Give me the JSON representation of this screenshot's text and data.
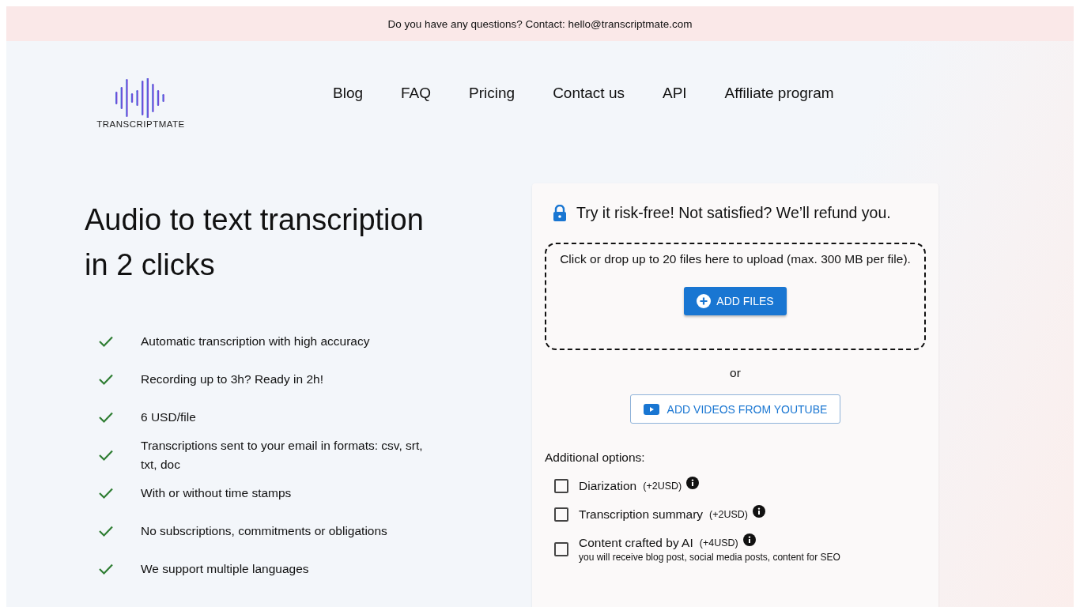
{
  "top_bar": {
    "text": "Do you have any questions? Contact: hello@transcriptmate.com"
  },
  "logo": {
    "text": "TRANSCRIPTMATE"
  },
  "nav": [
    {
      "label": "Blog"
    },
    {
      "label": "FAQ"
    },
    {
      "label": "Pricing"
    },
    {
      "label": "Contact us"
    },
    {
      "label": "API"
    },
    {
      "label": "Affiliate program"
    }
  ],
  "hero": {
    "title_lines": [
      "Audio to text transcription",
      "in 2 clicks"
    ],
    "features": [
      "Automatic transcription with high accuracy",
      "Recording up to 3h? Ready in 2h!",
      "6 USD/file",
      "Transcriptions sent to your email in formats: csv, srt, txt, doc",
      "With or without time stamps",
      "No subscriptions, commitments or obligations",
      "We support multiple languages"
    ]
  },
  "card": {
    "guarantee": "Try it risk-free! Not satisfied? We’ll refund you.",
    "dropzone_text": "Click or drop up to 20 files here to upload (max. 300 MB per file).",
    "add_files_button": "ADD FILES",
    "or": "or",
    "youtube_button": "ADD VIDEOS FROM YOUTUBE",
    "options_title": "Additional options:",
    "options": [
      {
        "label": "Diarization",
        "price": "(+2USD)",
        "checked": false
      },
      {
        "label": "Transcription summary",
        "price": "(+2USD)",
        "checked": false
      },
      {
        "label": "Content crafted by AI",
        "price": "(+4USD)",
        "checked": false,
        "note": "you will receive blog post, social media posts, content for SEO"
      }
    ]
  }
}
